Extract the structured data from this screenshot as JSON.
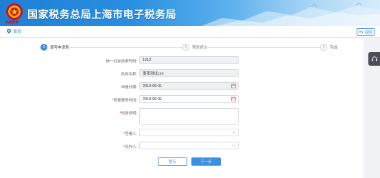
{
  "header": {
    "title": "国家税务总局上海市电子税务局",
    "emblem_caption": "中国税务"
  },
  "nav": {
    "home_label": "首页",
    "back_label": "返回"
  },
  "steps": [
    {
      "number": "1",
      "label": "填写申请表"
    },
    {
      "number": "2",
      "label": "预览提交"
    },
    {
      "number": "3",
      "label": "完成"
    }
  ],
  "form": {
    "credit_code": {
      "label": "统一社会信用代码:",
      "value": "1212"
    },
    "org_name": {
      "label": "机构名称:",
      "value": "墨阳测试zsh"
    },
    "apply_date": {
      "label": "申报日期:",
      "value": "2019-08-01"
    },
    "recovery_date": {
      "label": "恢复服务时间:",
      "value": "2019-08-01"
    },
    "recovery_note": {
      "label": "恢复说明:",
      "value": ""
    },
    "registrant": {
      "label": "签署人:",
      "value": ""
    },
    "handler": {
      "label": "经办人:",
      "value": ""
    }
  },
  "buttons": {
    "save_label": "暂存",
    "next_label": "下一步"
  },
  "colors": {
    "accent": "#3d8fe0",
    "banner_start": "#1f7fd4",
    "required": "#e33333"
  }
}
